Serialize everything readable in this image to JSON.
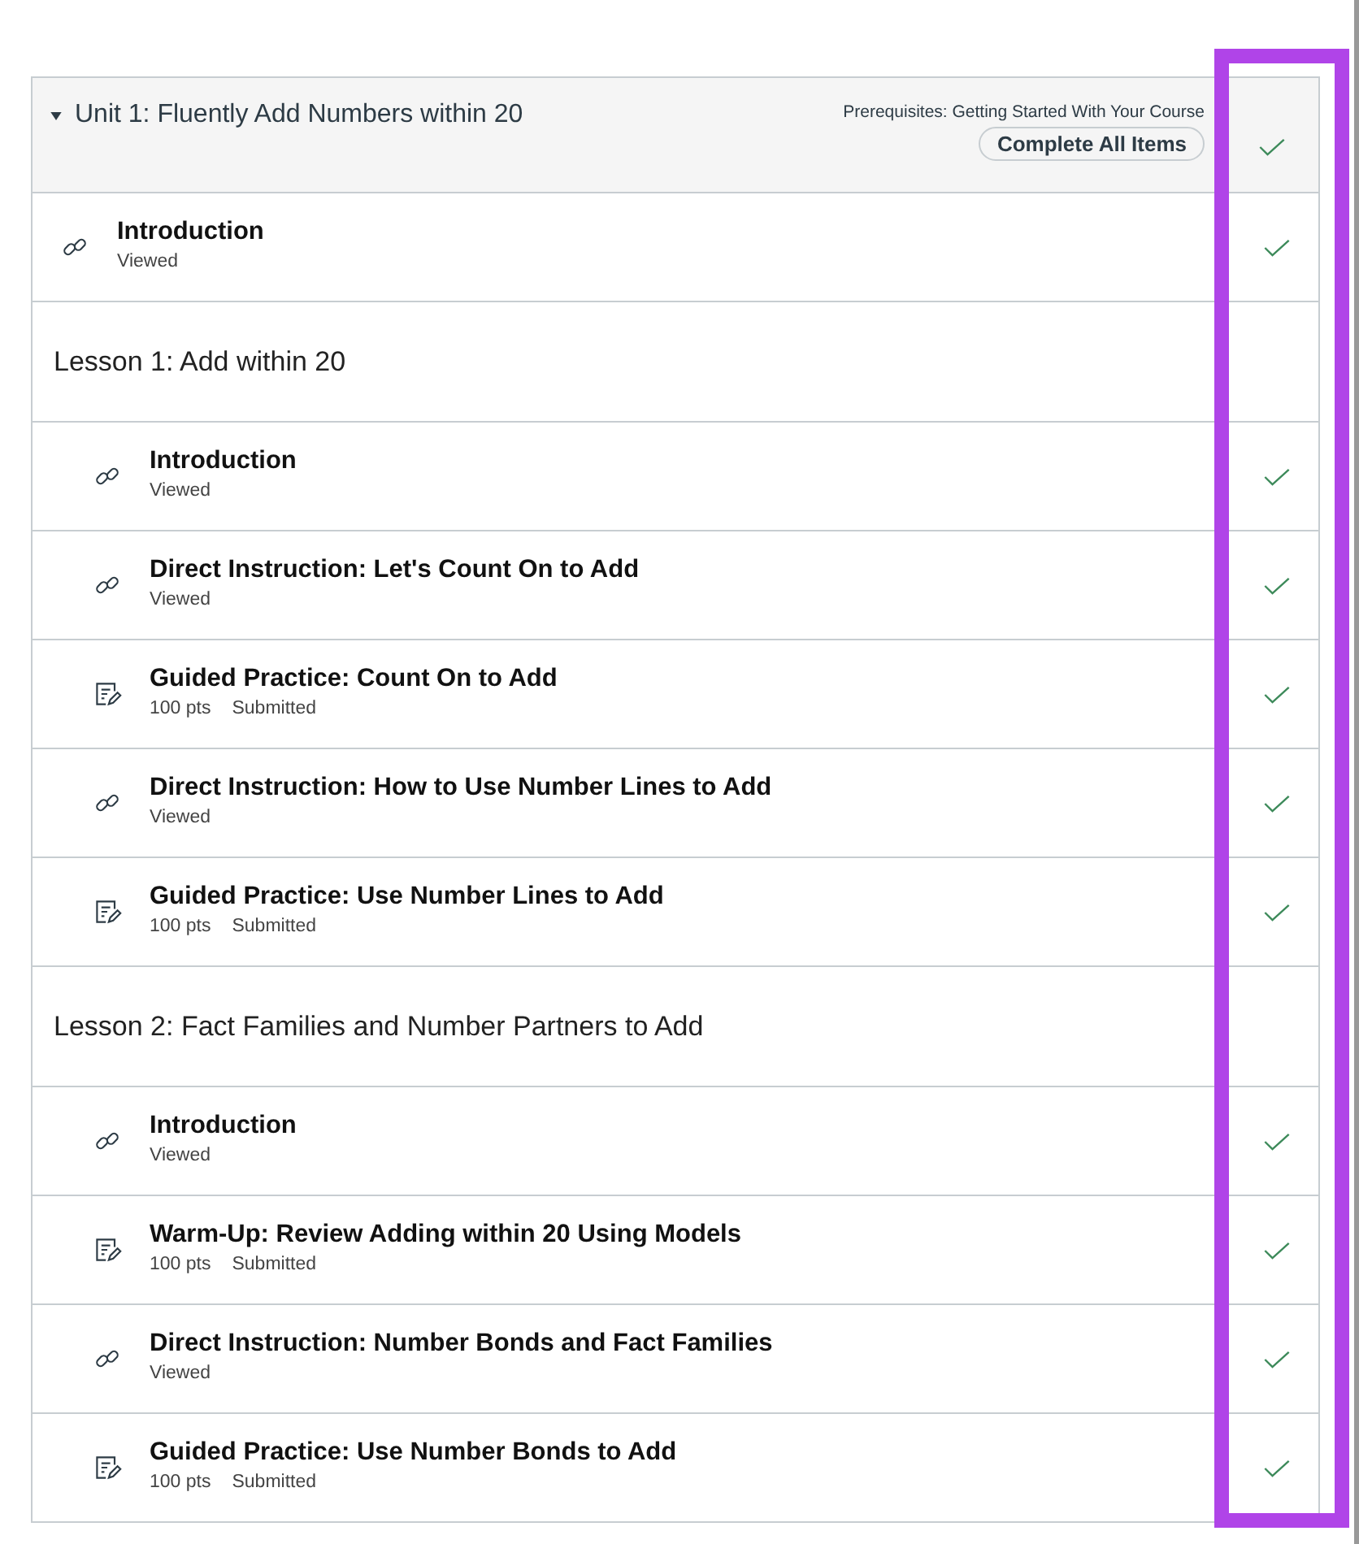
{
  "module": {
    "title": "Unit 1: Fluently Add Numbers within 20",
    "expanded": true,
    "prerequisites": "Prerequisites: Getting Started With Your Course",
    "complete_button": "Complete All Items",
    "completed": true,
    "items": [
      {
        "kind": "link",
        "title": "Introduction",
        "meta": [
          "Viewed"
        ],
        "completed": true
      },
      {
        "kind": "lesson",
        "title": "Lesson 1: Add within 20",
        "children": [
          {
            "kind": "link",
            "title": "Introduction",
            "meta": [
              "Viewed"
            ],
            "completed": true
          },
          {
            "kind": "link",
            "title": "Direct Instruction: Let's Count On to Add",
            "meta": [
              "Viewed"
            ],
            "completed": true
          },
          {
            "kind": "assignment",
            "title": "Guided Practice: Count On to Add",
            "meta": [
              "100 pts",
              "Submitted"
            ],
            "completed": true
          },
          {
            "kind": "link",
            "title": "Direct Instruction: How to Use Number Lines to Add",
            "meta": [
              "Viewed"
            ],
            "completed": true
          },
          {
            "kind": "assignment",
            "title": "Guided Practice: Use Number Lines to Add",
            "meta": [
              "100 pts",
              "Submitted"
            ],
            "completed": true
          }
        ]
      },
      {
        "kind": "lesson",
        "title": "Lesson 2: Fact Families and Number Partners to Add",
        "children": [
          {
            "kind": "link",
            "title": "Introduction",
            "meta": [
              "Viewed"
            ],
            "completed": true
          },
          {
            "kind": "assignment",
            "title": "Warm-Up: Review Adding within 20 Using Models",
            "meta": [
              "100 pts",
              "Submitted"
            ],
            "completed": true
          },
          {
            "kind": "link",
            "title": "Direct Instruction: Number Bonds and Fact Families",
            "meta": [
              "Viewed"
            ],
            "completed": true
          },
          {
            "kind": "assignment",
            "title": "Guided Practice: Use Number Bonds to Add",
            "meta": [
              "100 pts",
              "Submitted"
            ],
            "completed": true
          }
        ]
      }
    ]
  }
}
